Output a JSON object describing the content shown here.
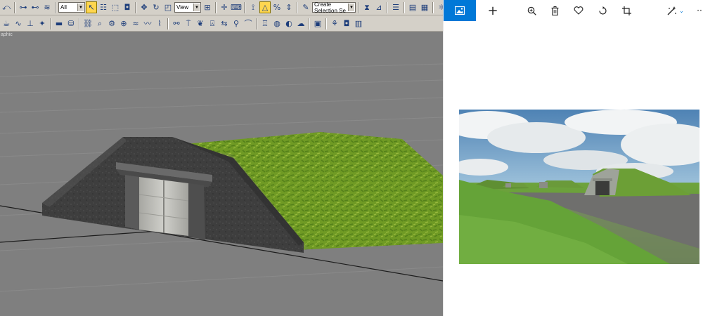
{
  "editor": {
    "toolbar1": {
      "selection_filter": "All",
      "reference_coord": "View",
      "named_selection_placeholder": "Create Selection Se"
    },
    "viewport": {
      "label": "aphic"
    }
  },
  "photos_app": {
    "toolbar": {
      "gallery_icon": "image-gallery-icon",
      "add_icon": "plus-icon",
      "zoom_icon": "zoom-in-icon",
      "delete_icon": "trash-icon",
      "favorite_icon": "heart-icon",
      "rotate_icon": "rotate-icon",
      "crop_icon": "crop-icon",
      "edit_icon": "edit-enhance-icon",
      "more_icon": "more-icon"
    },
    "accent_color": "#0078d7"
  }
}
